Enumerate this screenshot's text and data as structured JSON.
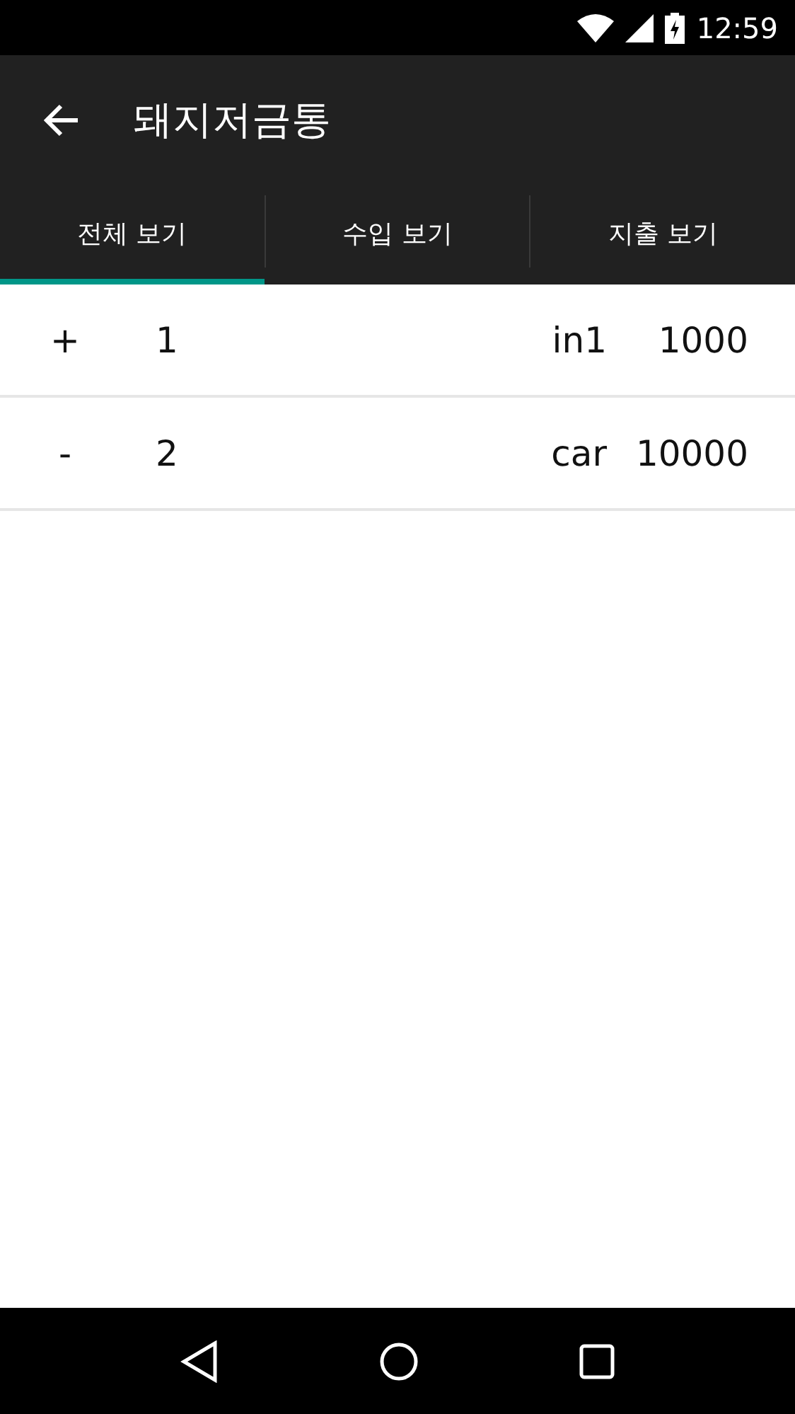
{
  "status_bar": {
    "time": "12:59"
  },
  "app_bar": {
    "title": "돼지저금통"
  },
  "tabs": [
    {
      "label": "전체 보기",
      "selected": true
    },
    {
      "label": "수입 보기",
      "selected": false
    },
    {
      "label": "지출 보기",
      "selected": false
    }
  ],
  "rows": [
    {
      "sign": "+",
      "number": "1",
      "name": "in1",
      "amount": "1000"
    },
    {
      "sign": "-",
      "number": "2",
      "name": "car",
      "amount": "10000"
    }
  ]
}
